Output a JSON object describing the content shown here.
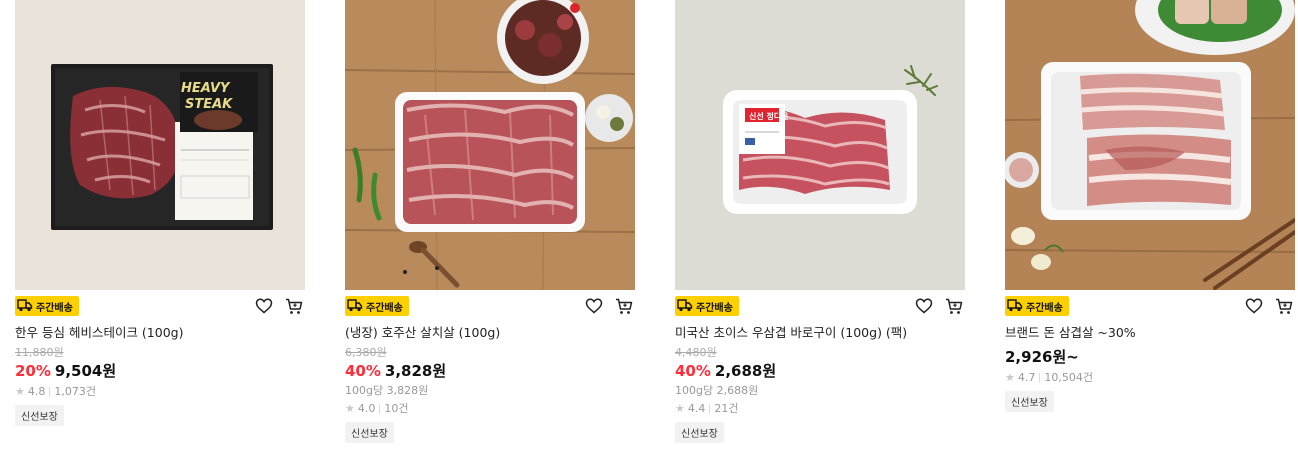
{
  "products": [
    {
      "delivery_badge": "주간배송",
      "name": "한우 등심 헤비스테이크 (100g)",
      "original_price": "11,880원",
      "discount": "20%",
      "price": "9,504원",
      "unit_price": "",
      "rating": "4.8",
      "review_count": "1,073건",
      "tag": "신선보장",
      "package_text": "HEAVY STEAK"
    },
    {
      "delivery_badge": "주간배송",
      "name": "(냉장) 호주산 살치살 (100g)",
      "original_price": "6,380원",
      "discount": "40%",
      "price": "3,828원",
      "unit_price": "100g당 3,828원",
      "rating": "4.0",
      "review_count": "10건",
      "tag": "신선보장"
    },
    {
      "delivery_badge": "주간배송",
      "name": "미국산 초이스 우삼겹 바로구이 (100g) (팩)",
      "original_price": "4,480원",
      "discount": "40%",
      "price": "2,688원",
      "unit_price": "100g당 2,688원",
      "rating": "4.4",
      "review_count": "21건",
      "tag": "신선보장",
      "package_text": "신선 정다운"
    },
    {
      "delivery_badge": "주간배송",
      "name": "브랜드 돈 삼겹살 ~30%",
      "original_price": "",
      "discount": "",
      "price": "2,926원~",
      "unit_price": "",
      "rating": "4.7",
      "review_count": "10,504건",
      "tag": "신선보장"
    }
  ],
  "colors": {
    "badge": "#ffd000",
    "discount": "#ff2e3b",
    "tag_bg": "#f2f2f2"
  },
  "icons": [
    "truck-icon",
    "heart-icon",
    "cart-icon",
    "star-icon"
  ]
}
